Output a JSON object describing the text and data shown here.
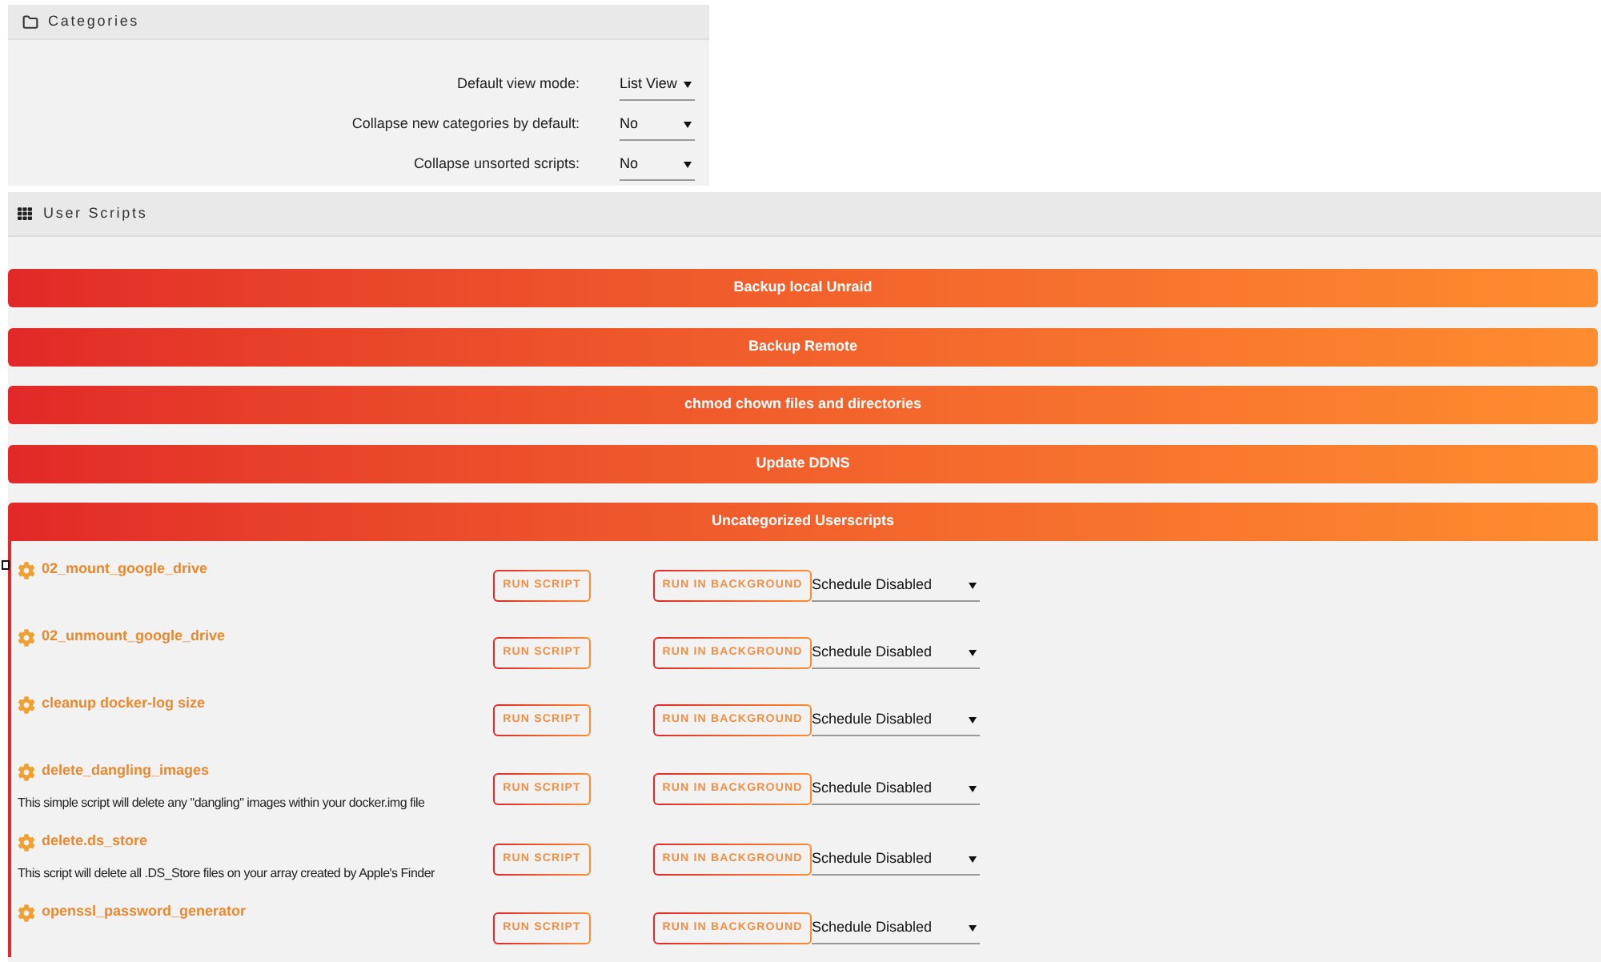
{
  "categories_panel": {
    "title": "Categories",
    "settings": [
      {
        "label": "Default view mode:",
        "value": "List View"
      },
      {
        "label": "Collapse new categories by default:",
        "value": "No"
      },
      {
        "label": "Collapse unsorted scripts:",
        "value": "No"
      }
    ]
  },
  "user_scripts": {
    "title": "User Scripts",
    "categories": [
      {
        "name": "Backup local Unraid",
        "expanded": false
      },
      {
        "name": "Backup Remote",
        "expanded": false
      },
      {
        "name": "chmod chown files and directories",
        "expanded": false
      },
      {
        "name": "Update DDNS",
        "expanded": false
      },
      {
        "name": "Uncategorized Userscripts",
        "expanded": true,
        "scripts": [
          {
            "name": "02_mount_google_drive",
            "run_button": "RUN SCRIPT",
            "background_button": "RUN IN BACKGROUND",
            "schedule": "Schedule Disabled"
          },
          {
            "name": "02_unmount_google_drive",
            "run_button": "RUN SCRIPT",
            "background_button": "RUN IN BACKGROUND",
            "schedule": "Schedule Disabled"
          },
          {
            "name": "cleanup docker-log size",
            "run_button": "RUN SCRIPT",
            "background_button": "RUN IN BACKGROUND",
            "schedule": "Schedule Disabled"
          },
          {
            "name": "delete_dangling_images",
            "description": "This simple script will delete any \"dangling\" images within your docker.img file",
            "run_button": "RUN SCRIPT",
            "background_button": "RUN IN BACKGROUND",
            "schedule": "Schedule Disabled"
          },
          {
            "name": "delete.ds_store",
            "description": "This script will delete all .DS_Store files on your array created by Apple's Finder",
            "run_button": "RUN SCRIPT",
            "background_button": "RUN IN BACKGROUND",
            "schedule": "Schedule Disabled"
          },
          {
            "name": "openssl_password_generator",
            "run_button": "RUN SCRIPT",
            "background_button": "RUN IN BACKGROUND",
            "schedule": "Schedule Disabled"
          }
        ]
      }
    ]
  }
}
